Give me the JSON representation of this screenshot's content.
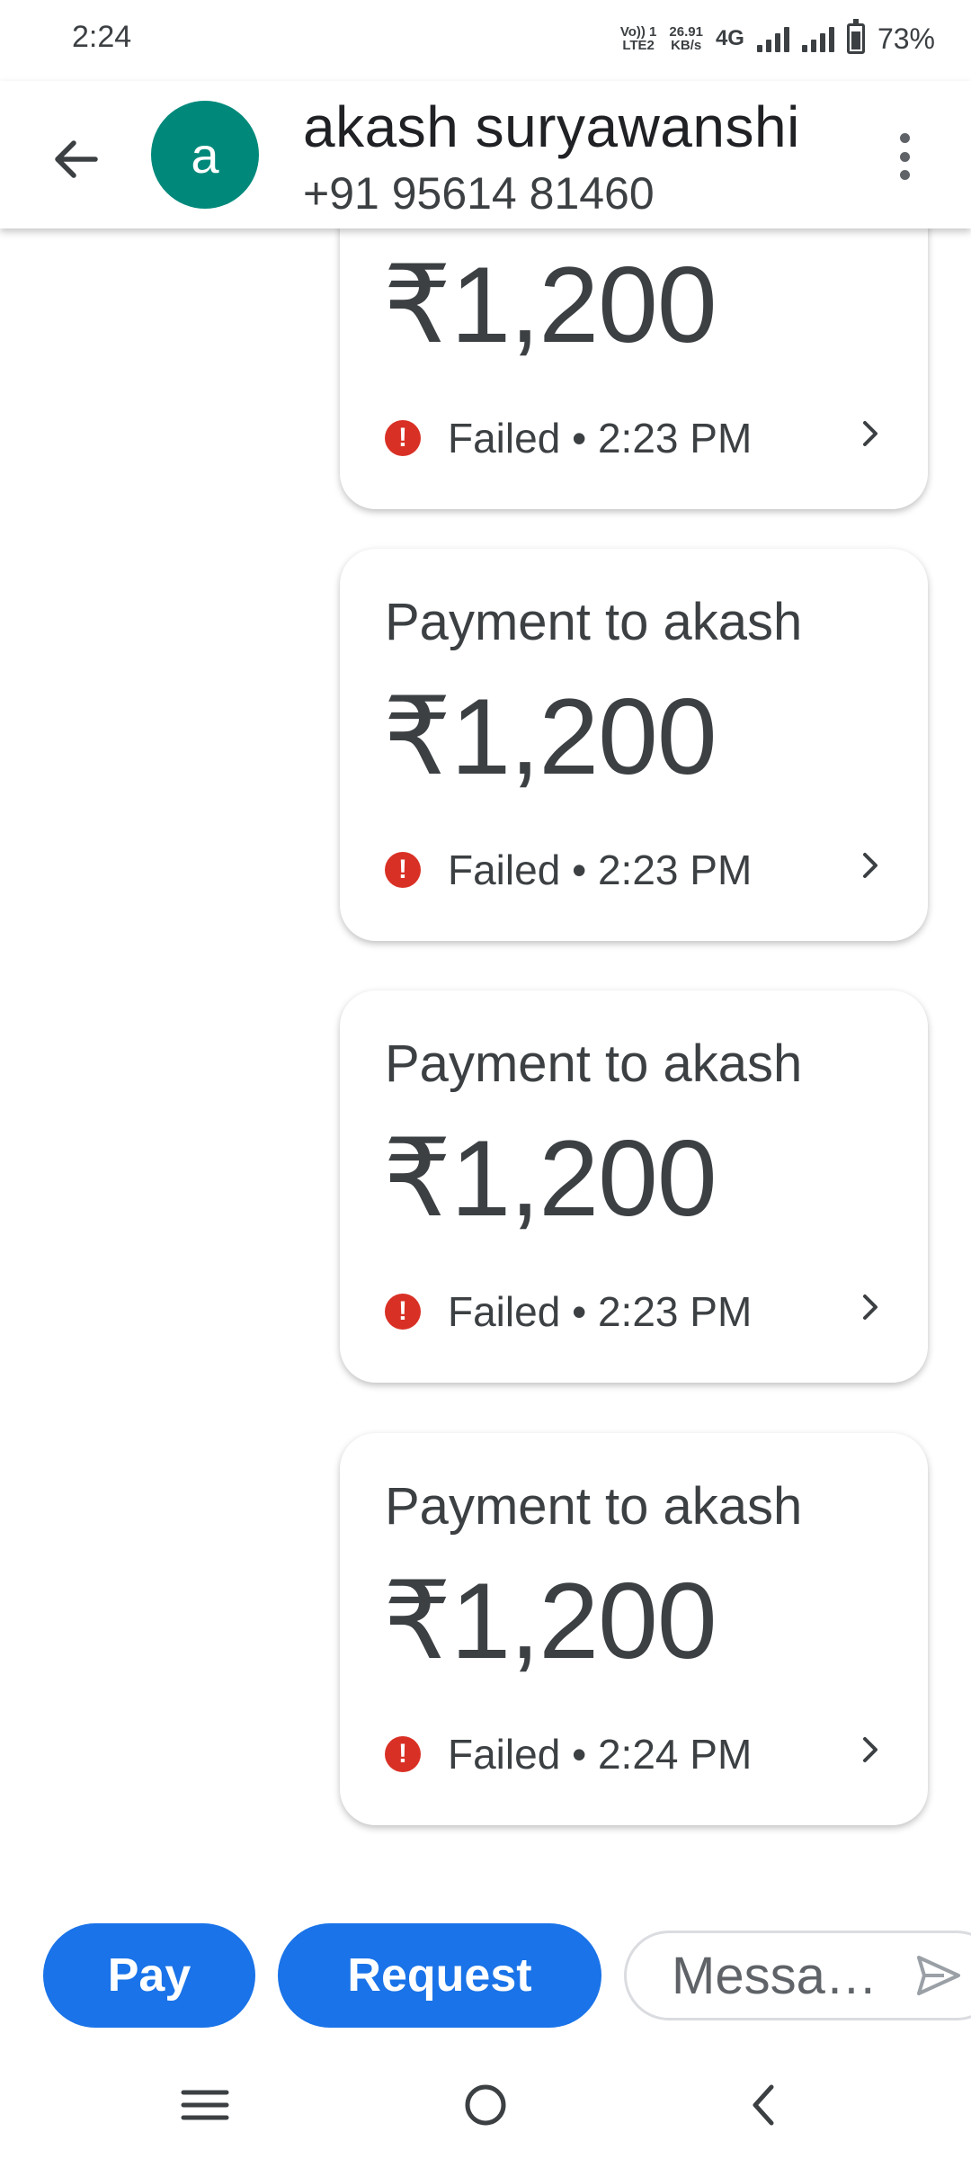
{
  "status_bar": {
    "time": "2:24",
    "volte_top": "Vo)) 1",
    "volte_bottom": "LTE2",
    "speed_value": "26.91",
    "speed_unit": "KB/s",
    "network": "4G",
    "battery_percent": "73%",
    "battery_level": 0.73
  },
  "header": {
    "back_icon": "arrow-left-icon",
    "avatar_letter": "a",
    "avatar_color": "#00897b",
    "contact_name": "akash suryawanshi",
    "contact_phone": "+91 95614 81460",
    "menu_icon": "more-vert-icon"
  },
  "payments": [
    {
      "title": "",
      "amount": "₹1,200",
      "status": "Failed • 2:23 PM"
    },
    {
      "title": "Payment to akash",
      "amount": "₹1,200",
      "status": "Failed • 2:23 PM"
    },
    {
      "title": "Payment to akash",
      "amount": "₹1,200",
      "status": "Failed • 2:23 PM"
    },
    {
      "title": "Payment to akash",
      "amount": "₹1,200",
      "status": "Failed • 2:24 PM"
    }
  ],
  "status_icon": "error-icon",
  "status_icon_color": "#d93025",
  "composer": {
    "pay_label": "Pay",
    "request_label": "Request",
    "message_placeholder": "Messa…",
    "button_color": "#1a73e8",
    "send_icon": "send-icon"
  },
  "nav_bar": {
    "items": [
      "menu-icon",
      "home-icon",
      "back-icon"
    ]
  }
}
